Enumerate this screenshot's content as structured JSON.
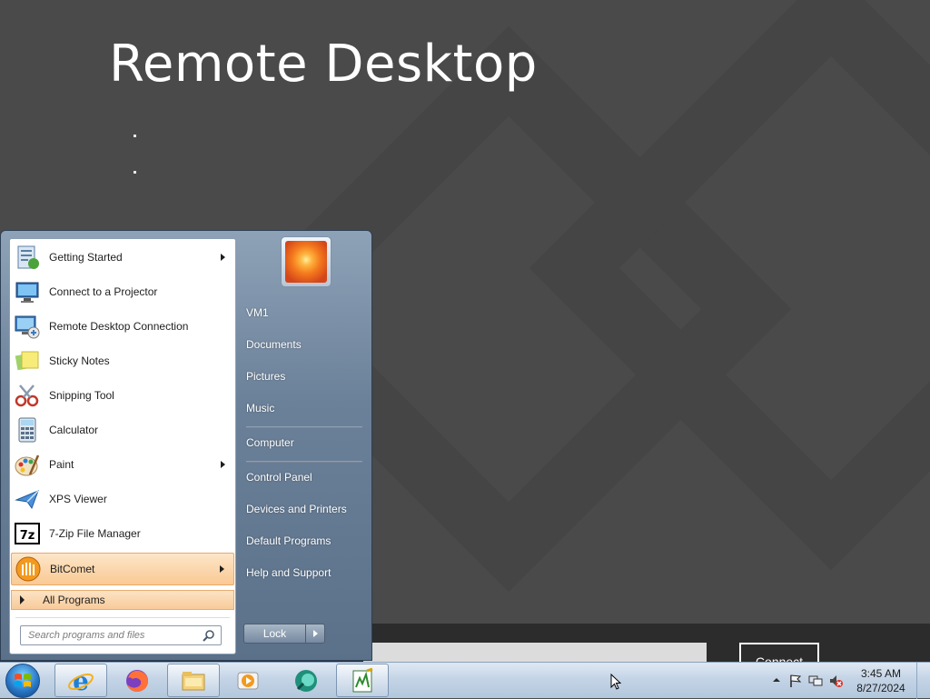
{
  "remote_desktop": {
    "title": "Remote Desktop",
    "connect_label": "Connect"
  },
  "start_menu": {
    "programs": [
      {
        "label": "Getting Started",
        "icon": "getting-started-icon",
        "has_submenu": true
      },
      {
        "label": "Connect to a Projector",
        "icon": "projector-icon",
        "has_submenu": false
      },
      {
        "label": "Remote Desktop Connection",
        "icon": "remote-desktop-icon",
        "has_submenu": false
      },
      {
        "label": "Sticky Notes",
        "icon": "sticky-notes-icon",
        "has_submenu": false
      },
      {
        "label": "Snipping Tool",
        "icon": "scissors-icon",
        "has_submenu": false
      },
      {
        "label": "Calculator",
        "icon": "calculator-icon",
        "has_submenu": false
      },
      {
        "label": "Paint",
        "icon": "paint-icon",
        "has_submenu": true
      },
      {
        "label": "XPS Viewer",
        "icon": "xps-viewer-icon",
        "has_submenu": false
      },
      {
        "label": "7-Zip File Manager",
        "icon": "7zip-icon",
        "has_submenu": false
      },
      {
        "label": "BitComet",
        "icon": "bitcomet-icon",
        "has_submenu": true,
        "highlighted": true
      }
    ],
    "all_programs_label": "All Programs",
    "search_placeholder": "Search programs and files",
    "right_items": [
      {
        "label": "VM1"
      },
      {
        "label": "Documents"
      },
      {
        "label": "Pictures"
      },
      {
        "label": "Music"
      },
      {
        "label": "Computer"
      },
      {
        "label": "Control Panel"
      },
      {
        "label": "Devices and Printers"
      },
      {
        "label": "Default Programs"
      },
      {
        "label": "Help and Support"
      }
    ],
    "lock_label": "Lock"
  },
  "taskbar": {
    "pinned": [
      {
        "name": "internet-explorer",
        "icon": "ie-icon",
        "active": true
      },
      {
        "name": "firefox",
        "icon": "firefox-icon",
        "active": false
      },
      {
        "name": "file-explorer",
        "icon": "folder-icon",
        "active": true
      },
      {
        "name": "media-player",
        "icon": "media-player-icon",
        "active": false
      },
      {
        "name": "app-green",
        "icon": "app-icon",
        "active": false
      },
      {
        "name": "editor",
        "icon": "editor-icon",
        "active": true
      }
    ],
    "clock_time": "3:45 AM",
    "clock_date": "8/27/2024"
  },
  "colors": {
    "highlight": "#f9c993",
    "menu_blue": "#6b8199",
    "taskbar": "#c4d4e6"
  }
}
